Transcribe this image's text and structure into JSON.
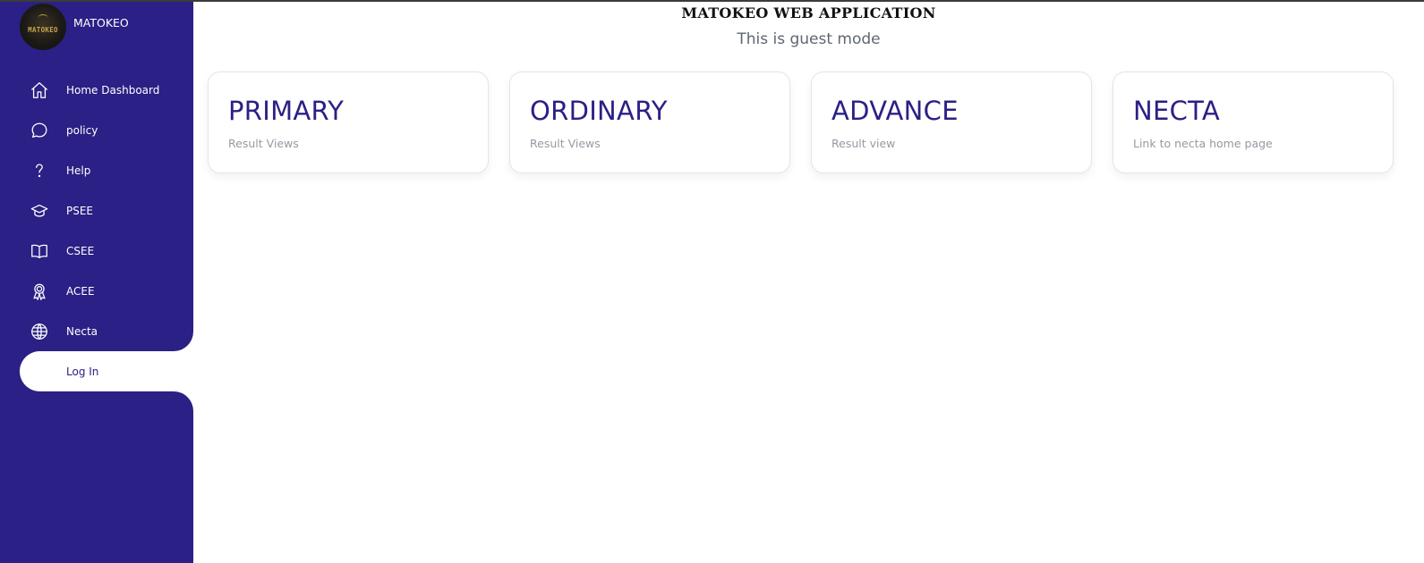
{
  "app": {
    "title": "MATOKEO WEB APPLICATION",
    "mode_text": "This is guest mode"
  },
  "brand": {
    "name": "MATOKEO",
    "logo_text": "MATOKEO"
  },
  "sidebar": {
    "items": [
      {
        "label": "Home Dashboard",
        "icon": "home-icon"
      },
      {
        "label": "policy",
        "icon": "chat-bubble-icon"
      },
      {
        "label": "Help",
        "icon": "question-icon"
      },
      {
        "label": "PSEE",
        "icon": "graduation-cap-icon"
      },
      {
        "label": "CSEE",
        "icon": "book-open-icon"
      },
      {
        "label": "ACEE",
        "icon": "award-ribbon-icon"
      },
      {
        "label": "Necta",
        "icon": "globe-icon"
      },
      {
        "label": "Log In",
        "icon": ""
      }
    ],
    "active_item": "Log In"
  },
  "cards": [
    {
      "title": "PRIMARY",
      "subtitle": "Result Views"
    },
    {
      "title": "ORDINARY",
      "subtitle": "Result Views"
    },
    {
      "title": "ADVANCE",
      "subtitle": "Result view"
    },
    {
      "title": "NECTA",
      "subtitle": "Link to necta home page"
    }
  ],
  "colors": {
    "sidebar_bg": "#2b2085",
    "accent_text": "#2b2085",
    "page_bg": "#ffffff"
  }
}
